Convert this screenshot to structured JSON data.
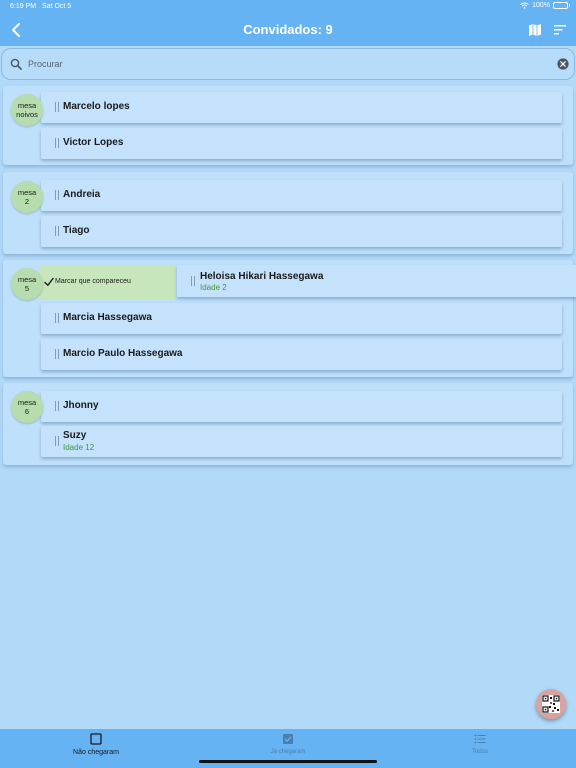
{
  "status_bar": {
    "time": "6:19 PM",
    "date": "Sat Oct 5",
    "battery": "100%"
  },
  "nav": {
    "title": "Convidados: 9",
    "icons": [
      "chevron-left-icon",
      "map-icon",
      "sort-icon"
    ]
  },
  "search": {
    "placeholder": "Procurar",
    "value": ""
  },
  "groups": [
    {
      "label": [
        "mesa",
        "noivos"
      ],
      "guests": [
        {
          "name": "Marcelo lopes"
        },
        {
          "name": "Victor Lopes"
        }
      ]
    },
    {
      "label": [
        "mesa",
        "2"
      ],
      "guests": [
        {
          "name": "Andreia"
        },
        {
          "name": "Tiago"
        }
      ]
    },
    {
      "label": [
        "mesa",
        "5"
      ],
      "guests": [
        {
          "name": "Heloisa Hikari Hassegawa",
          "age": "Idade 2"
        },
        {
          "name": "Marcia Hassegawa"
        },
        {
          "name": "Marcio Paulo Hassegawa"
        }
      ]
    },
    {
      "label": [
        "mesa",
        "6"
      ],
      "guests": [
        {
          "name": "Jhonny"
        },
        {
          "name": "Suzy",
          "age": "Idade 12"
        }
      ]
    }
  ],
  "swipe_action": {
    "label": "Marcar que compareceu",
    "color": "#c7e6bc"
  },
  "tabs": [
    {
      "label": "Não chegaram",
      "icon": "square-icon",
      "active": true
    },
    {
      "label": "Já chegaram",
      "icon": "checked-square-icon",
      "active": false
    },
    {
      "label": "Todos",
      "icon": "list-icon",
      "active": false
    }
  ],
  "colors": {
    "bar": "#65b3f3",
    "background": "#b3d9f9",
    "badge": "#b7dcae",
    "age_text": "#3d9a3a"
  }
}
